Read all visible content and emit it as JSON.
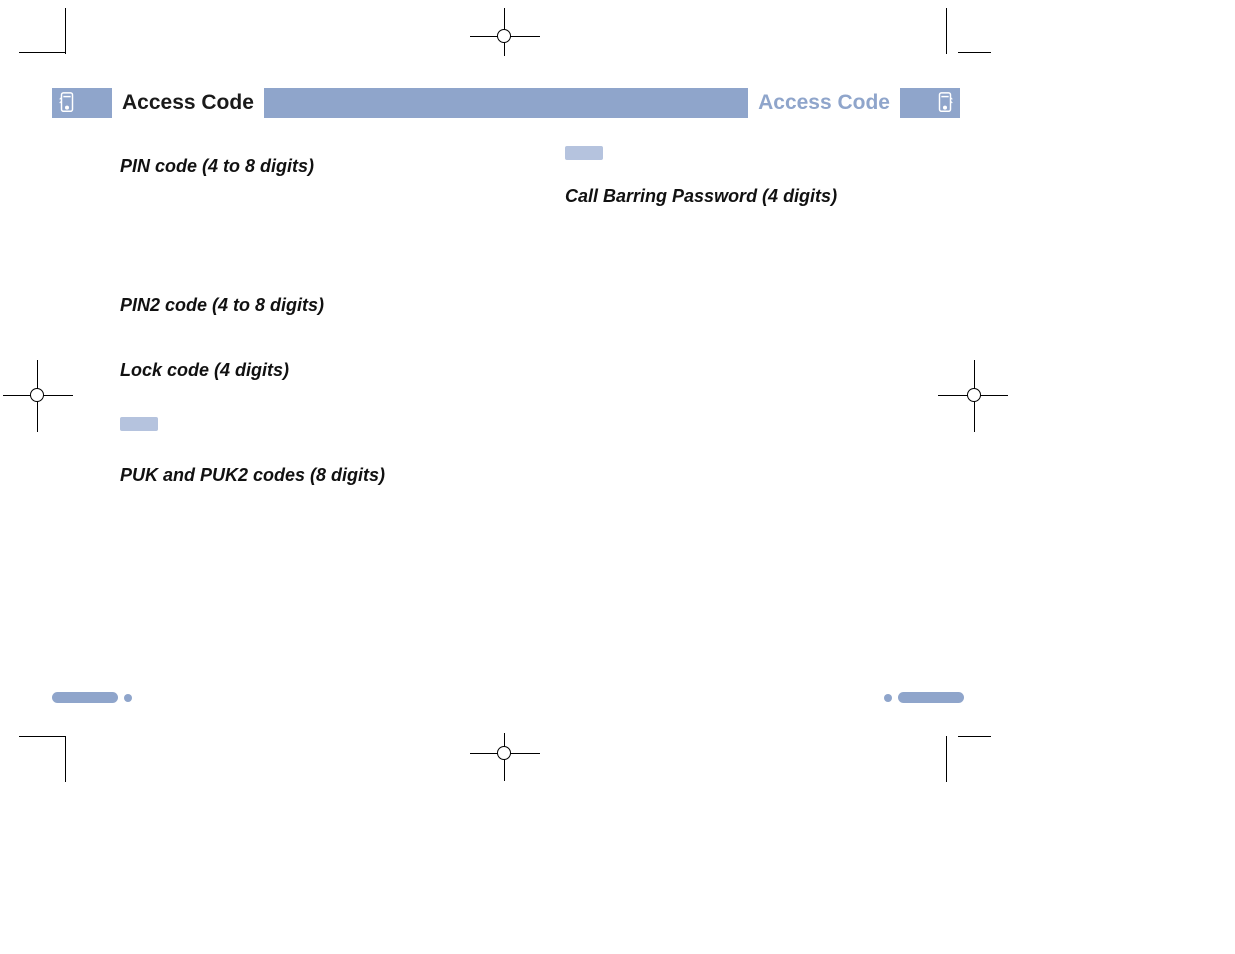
{
  "header": {
    "title_left": "Access Code",
    "title_right": "Access Code"
  },
  "left_page": {
    "headings": [
      "PIN code (4 to 8 digits)",
      "PIN2 code (4 to 8 digits)",
      "Lock code (4 digits)",
      "PUK and PUK2 codes (8 digits)"
    ]
  },
  "right_page": {
    "headings": [
      "Call Barring Password (4 digits)"
    ]
  },
  "accent_color": "#8fa5cb"
}
